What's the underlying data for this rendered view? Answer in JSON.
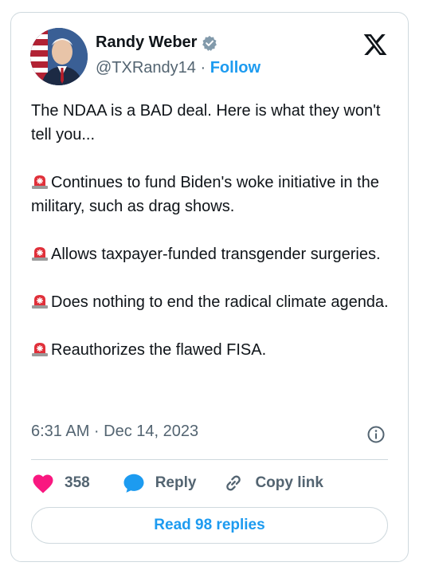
{
  "author": {
    "name": "Randy Weber",
    "handle": "@TXRandy14",
    "separator": "·",
    "follow_label": "Follow",
    "verified_color": "#829aab"
  },
  "tweet": {
    "paragraphs": [
      {
        "text": "The NDAA is a BAD deal. Here is what they won't tell you...",
        "siren": false
      },
      {
        "text": "Continues to fund Biden's woke initiative in the military, such as drag shows.",
        "siren": true
      },
      {
        "text": "Allows taxpayer-funded transgender surgeries.",
        "siren": true
      },
      {
        "text": "Does nothing to end the radical climate agenda.",
        "siren": true
      },
      {
        "text": "Reauthorizes the flawed FISA.",
        "siren": true
      }
    ],
    "timestamp": "6:31 AM · Dec 14, 2023"
  },
  "actions": {
    "like_count": "358",
    "reply_label": "Reply",
    "copy_link_label": "Copy link"
  },
  "read_replies_label": "Read 98 replies",
  "icons": {
    "logo": "x-logo-icon",
    "verified": "verified-badge-icon",
    "siren": "siren-emoji-icon",
    "info": "info-icon",
    "like": "heart-icon",
    "reply": "speech-bubble-icon",
    "copy": "link-icon"
  },
  "colors": {
    "accent": "#1d9bf0",
    "like": "#f91880",
    "muted": "#536471",
    "siren": "#e0303a"
  }
}
